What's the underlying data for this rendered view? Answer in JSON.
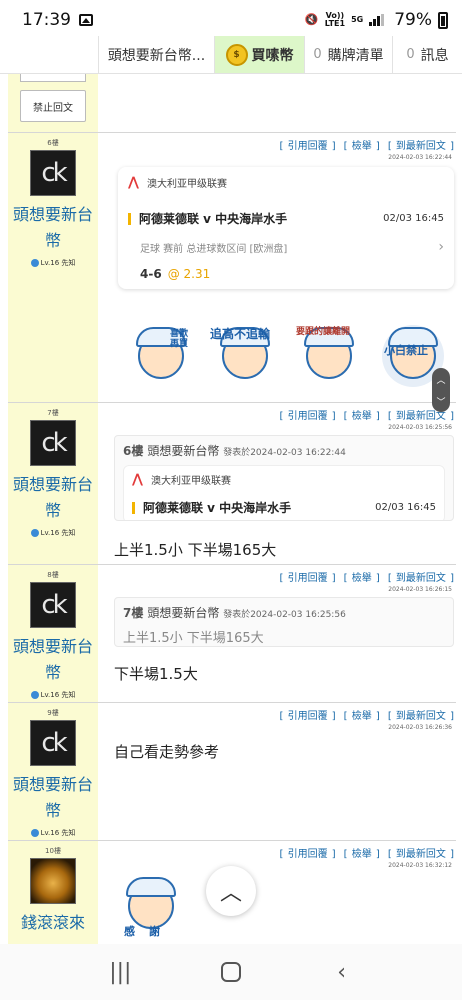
{
  "status_bar": {
    "time": "17:39",
    "network_top": "Vo))",
    "network_bottom": "LTE1",
    "net_type": "5G",
    "battery": "79%"
  },
  "tabs": [
    {
      "label": "頭想要新台幣..."
    },
    {
      "label": "買嗉幣",
      "icon": "coin-icon"
    },
    {
      "count": "0",
      "label": "購牌清單"
    },
    {
      "count": "0",
      "label": "訊息"
    }
  ],
  "top_fragment": {
    "ban_button": "禁止回文"
  },
  "action_links": {
    "quote": "[ 引用回覆 ]",
    "report": "[ 檢舉 ]",
    "latest": "[ 到最新回文 ]"
  },
  "posts": [
    {
      "floor": "6樓",
      "user": "頭想要新台幣",
      "level": "Lv.16 先知",
      "time": "2024-02-03 16:22:44",
      "match": {
        "league": "澳大利亚甲级联赛",
        "title": "阿德莱德联 v 中央海岸水手",
        "time": "02/03 16:45",
        "meta": "足球  赛前  总进球数区间 [欧洲盘]",
        "score": "4-6",
        "odds": "@ 2.31"
      },
      "stickers": [
        {
          "words": "喜歡再買"
        },
        {
          "words": "追高不追輸"
        },
        {
          "words": "要跟的讓離開"
        },
        {
          "words": "小白禁止"
        }
      ]
    },
    {
      "floor": "7樓",
      "user": "頭想要新台幣",
      "level": "Lv.16 先知",
      "time": "2024-02-03 16:25:56",
      "quote": {
        "floor": "6樓",
        "user": "頭想要新台幣",
        "date": "發表於2024-02-03 16:22:44",
        "league": "澳大利亚甲级联赛",
        "title": "阿德莱德联 v 中央海岸水手",
        "time": "02/03 16:45"
      },
      "text": "上半1.5小 下半場165大"
    },
    {
      "floor": "8樓",
      "user": "頭想要新台幣",
      "level": "Lv.16 先知",
      "time": "2024-02-03 16:26:15",
      "quote": {
        "floor": "7樓",
        "user": "頭想要新台幣",
        "date": "發表於2024-02-03 16:25:56",
        "body": "上半1.5小 下半場165大"
      },
      "text": "下半場1.5大"
    },
    {
      "floor": "9樓",
      "user": "頭想要新台幣",
      "level": "Lv.16 先知",
      "time": "2024-02-03 16:26:36",
      "text": "自己看走勢參考"
    },
    {
      "floor": "10樓",
      "user": "錢滾滾來",
      "time": "2024-02-03 16:32:12",
      "sticker": {
        "words": "感謝"
      }
    }
  ],
  "avatar_text": "ck"
}
